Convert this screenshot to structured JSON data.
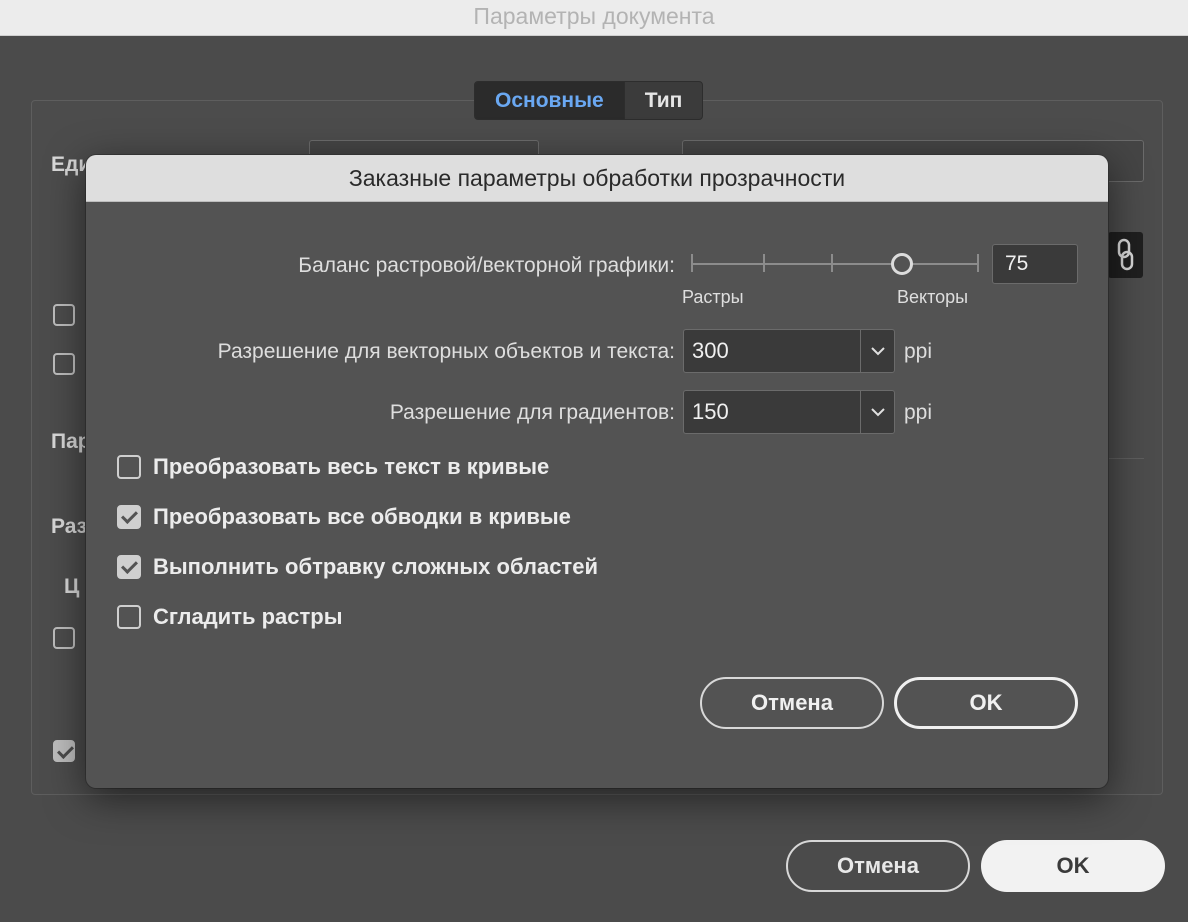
{
  "window": {
    "title": "Параметры документа",
    "tabs": [
      {
        "label": "Основные",
        "active": true
      },
      {
        "label": "Тип",
        "active": false
      }
    ],
    "partial_labels": [
      "Еди",
      "Пар",
      "Раз",
      "Ц"
    ],
    "buttons": {
      "cancel": "Отмена",
      "ok": "OK"
    }
  },
  "dialog": {
    "title": "Заказные параметры обработки прозрачности",
    "balance": {
      "label": "Баланс растровой/векторной графики:",
      "value": "75",
      "value_fraction": 0.75,
      "left_caption": "Растры",
      "right_caption": "Векторы"
    },
    "vector_resolution": {
      "label": "Разрешение для векторных объектов и текста:",
      "value": "300",
      "unit": "ppi"
    },
    "gradient_resolution": {
      "label": "Разрешение для градиентов:",
      "value": "150",
      "unit": "ppi"
    },
    "checkboxes": [
      {
        "label": "Преобразовать весь текст в кривые",
        "checked": false
      },
      {
        "label": "Преобразовать все обводки в кривые",
        "checked": true
      },
      {
        "label": "Выполнить обтравку сложных областей",
        "checked": true
      },
      {
        "label": "Сгладить растры",
        "checked": false
      }
    ],
    "buttons": {
      "cancel": "Отмена",
      "ok": "OK"
    }
  },
  "colors": {
    "background": "#4b4b4b",
    "dialog": "#535353",
    "accent_tab": "#6aa8f2",
    "titlebar": "#dedede"
  },
  "icons": {
    "link": "link-icon",
    "chevron": "chevron-down-icon"
  }
}
